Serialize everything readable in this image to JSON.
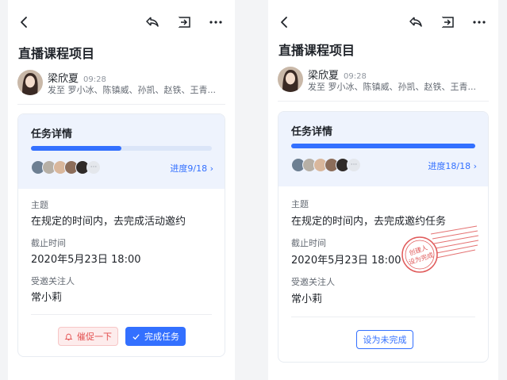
{
  "colors": {
    "accent": "#3370ff",
    "remind": "#e34d4d",
    "stamp": "#e05a5a"
  },
  "icons": [
    "back-icon",
    "reply-icon",
    "forward-icon",
    "more-icon",
    "bell-icon",
    "check-icon",
    "chevron-right-icon"
  ],
  "left": {
    "title": "直播课程项目",
    "sender_name": "梁欣夏",
    "sender_time": "09:28",
    "recipients": "发至 罗小冰、陈镇威、孙凯、赵铁、王青...",
    "card_title": "任务详情",
    "progress": 0.5,
    "progress_text": "进度9/18",
    "more_avatars": "···",
    "subject_label": "主题",
    "subject_value": "在规定的时间内，去完成活动邀约",
    "deadline_label": "截止时间",
    "deadline_value": "2020年5月23日 18:00",
    "follower_label": "受邀关注人",
    "follower_value": "常小莉",
    "remind_button": "催促一下",
    "done_button": "完成任务"
  },
  "right": {
    "title": "直播课程项目",
    "sender_name": "梁欣夏",
    "sender_time": "09:28",
    "recipients": "发至 罗小冰、陈镇威、孙凯、赵铁、王青...",
    "card_title": "任务详情",
    "progress": 1.0,
    "progress_text": "进度18/18",
    "more_avatars": "···",
    "subject_label": "主题",
    "subject_value": "在规定的时间内，去完成邀约任务",
    "deadline_label": "截止时间",
    "deadline_value": "2020年5月23日 18:00",
    "follower_label": "受邀关注人",
    "follower_value": "常小莉",
    "stamp_text_line1": "创建人",
    "stamp_text_line2": "设为完成",
    "undone_button": "设为未完成"
  }
}
